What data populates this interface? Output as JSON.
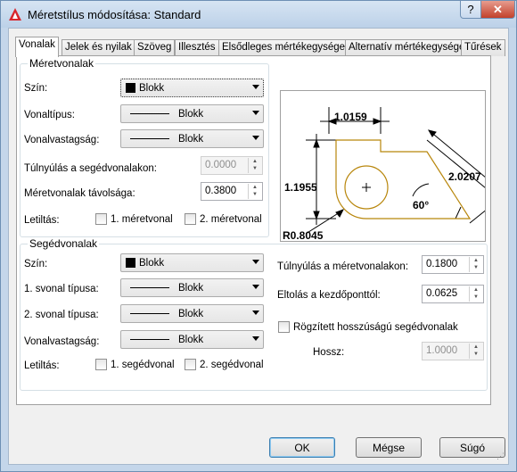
{
  "window": {
    "title": "Méretstílus módosítása: Standard",
    "help_label": "?",
    "close_label": "✕"
  },
  "tabs": [
    {
      "label": "Vonalak"
    },
    {
      "label": "Jelek és nyilak"
    },
    {
      "label": "Szöveg"
    },
    {
      "label": "Illesztés"
    },
    {
      "label": "Elsődleges mértékegységek"
    },
    {
      "label": "Alternatív mértékegységek"
    },
    {
      "label": "Tűrések"
    }
  ],
  "dimension_lines": {
    "title": "Méretvonalak",
    "color_label": "Szín:",
    "color_value": "Blokk",
    "linetype_label": "Vonaltípus:",
    "linetype_value": "Blokk",
    "lineweight_label": "Vonalvastagság:",
    "lineweight_value": "Blokk",
    "extend_label": "Túlnyúlás a segédvonalakon:",
    "extend_value": "0.0000",
    "baseline_label": "Méretvonalak távolsága:",
    "baseline_value": "0.3800",
    "suppress_label": "Letiltás:",
    "suppress_1": "1. méretvonal",
    "suppress_2": "2. méretvonal"
  },
  "extension_lines": {
    "title": "Segédvonalak",
    "color_label": "Szín:",
    "color_value": "Blokk",
    "linetype1_label": "1. svonal típusa:",
    "linetype1_value": "Blokk",
    "linetype2_label": "2. svonal típusa:",
    "linetype2_value": "Blokk",
    "lineweight_label": "Vonalvastagság:",
    "lineweight_value": "Blokk",
    "suppress_label": "Letiltás:",
    "suppress_1": "1. segédvonal",
    "suppress_2": "2. segédvonal",
    "extend_label": "Túlnyúlás a méretvonalakon:",
    "extend_value": "0.1800",
    "offset_label": "Eltolás a kezdőponttól:",
    "offset_value": "0.0625",
    "fixed_label": "Rögzített hosszúságú segédvonalak",
    "length_label": "Hossz:",
    "length_value": "1.0000"
  },
  "preview": {
    "dim_top": "1.0159",
    "dim_left": "1.1955",
    "dim_right": "2.0207",
    "angle": "60°",
    "radius": "R0.8045",
    "outline_color": "#b8860b"
  },
  "buttons": {
    "ok": "OK",
    "cancel": "Mégse",
    "help": "Súgó"
  },
  "colors": {
    "accent": "#3c7fb1"
  }
}
